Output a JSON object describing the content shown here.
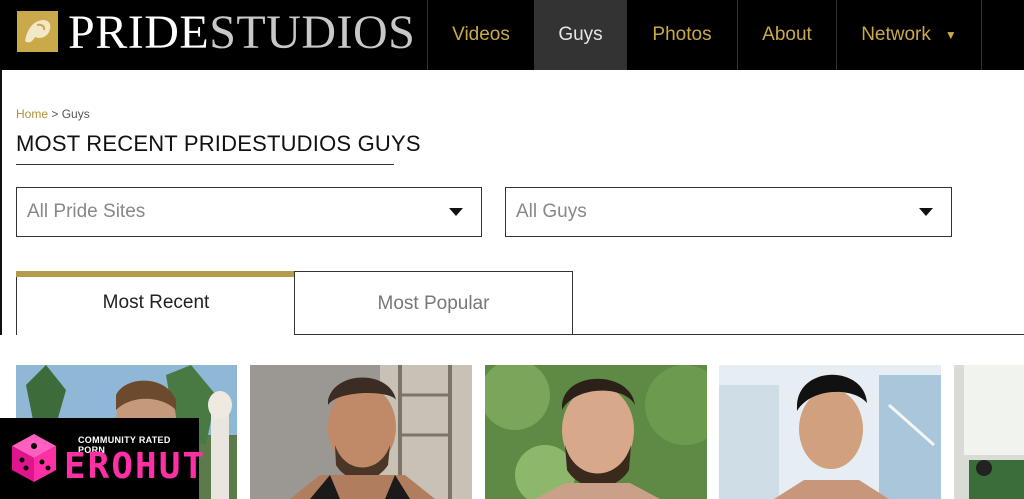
{
  "header": {
    "logo_left": "PRIDE",
    "logo_right": "STUDIOS",
    "nav": [
      {
        "label": "Videos",
        "active": false
      },
      {
        "label": "Guys",
        "active": true
      },
      {
        "label": "Photos",
        "active": false
      },
      {
        "label": "About",
        "active": false
      },
      {
        "label": "Network",
        "active": false,
        "dropdown": true
      }
    ]
  },
  "breadcrumb": {
    "home": "Home",
    "separator": ">",
    "current": "Guys"
  },
  "page_title": "MOST RECENT PRIDESTUDIOS GUYS",
  "filters": {
    "sites": {
      "value": "All Pride Sites"
    },
    "guys": {
      "value": "All Guys"
    }
  },
  "tabs": [
    {
      "label": "Most Recent",
      "active": true
    },
    {
      "label": "Most Popular",
      "active": false
    }
  ],
  "watermark": {
    "caption": "COMMUNITY RATED PORN",
    "brand": "EROHUT"
  },
  "colors": {
    "gold": "#c9a94a",
    "nav_bg": "#000000",
    "active_nav": "#333333",
    "pink": "#ff2fa5"
  }
}
